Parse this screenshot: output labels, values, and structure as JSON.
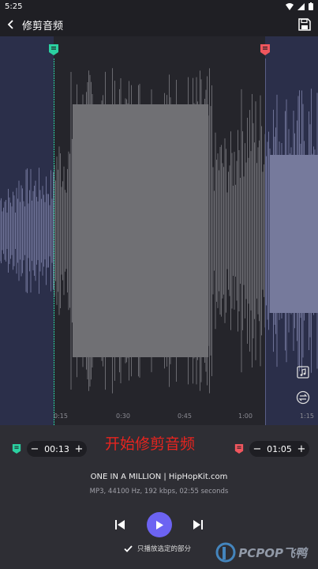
{
  "status_bar": {
    "time": "5:25"
  },
  "app_bar": {
    "title": "修剪音频"
  },
  "timeline": {
    "ticks": [
      "0:15",
      "0:30",
      "0:45",
      "1:00",
      "1:15"
    ]
  },
  "trim": {
    "start_time": "00:13",
    "end_time": "01:05",
    "minus": "−",
    "plus": "+"
  },
  "overlay_caption": "开始修剪音频",
  "track": {
    "title": "ONE IN A MILLION | HipHopKit.com",
    "meta": "MP3, 44100 Hz, 192 kbps, 02:55 seconds"
  },
  "options": {
    "only_play_selected": "只播放选定的部分",
    "only_play_selected_checked": true
  },
  "watermark": {
    "text": "PCPOP飞鸭"
  },
  "colors": {
    "accent": "#6c63f2",
    "start_marker": "#2bd1a1",
    "end_marker": "#f0565e",
    "caption": "#e8241f"
  }
}
